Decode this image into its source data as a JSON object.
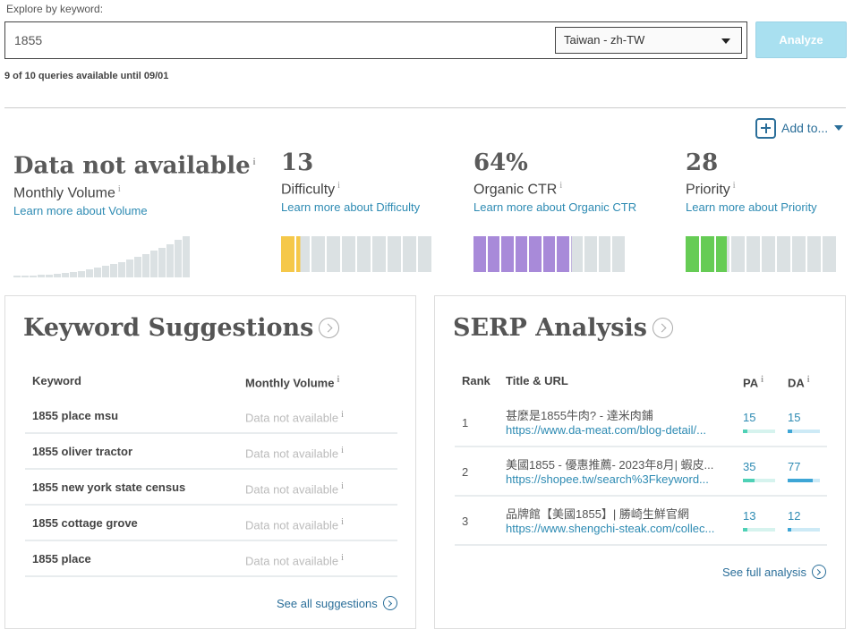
{
  "search": {
    "label": "Explore by keyword:",
    "value": "1855",
    "locale": "Taiwan - zh-TW",
    "analyze_label": "Analyze",
    "queries_text": "9 of 10 queries available until 09/01"
  },
  "add_to_label": "Add to...",
  "metrics": {
    "volume": {
      "value": "Data not available",
      "label": "Monthly Volume",
      "link": "Learn more about Volume"
    },
    "difficulty": {
      "value": "13",
      "label": "Difficulty",
      "link": "Learn more about Difficulty",
      "fill": 0.13,
      "color": "#f5c84a"
    },
    "ctr": {
      "value": "64%",
      "label": "Organic CTR",
      "link": "Learn more about Organic CTR",
      "fill": 0.64,
      "color": "#a88ad9"
    },
    "priority": {
      "value": "28",
      "label": "Priority",
      "link": "Learn more about Priority",
      "fill": 0.28,
      "color": "#66cc55"
    }
  },
  "suggestions": {
    "title": "Keyword Suggestions",
    "col_keyword": "Keyword",
    "col_volume": "Monthly Volume",
    "rows": [
      {
        "keyword": "1855 place msu",
        "volume": "Data not available"
      },
      {
        "keyword": "1855 oliver tractor",
        "volume": "Data not available"
      },
      {
        "keyword": "1855 new york state census",
        "volume": "Data not available"
      },
      {
        "keyword": "1855 cottage grove",
        "volume": "Data not available"
      },
      {
        "keyword": "1855 place",
        "volume": "Data not available"
      }
    ],
    "see_all": "See all suggestions"
  },
  "serp": {
    "title": "SERP Analysis",
    "col_rank": "Rank",
    "col_title": "Title & URL",
    "col_pa": "PA",
    "col_da": "DA",
    "rows": [
      {
        "rank": "1",
        "title": "甚麼是1855牛肉? - 達米肉鋪",
        "url": "https://www.da-meat.com/blog-detail/...",
        "pa": "15",
        "da": "15",
        "pa_fill": 0.15,
        "da_fill": 0.15
      },
      {
        "rank": "2",
        "title": "美國1855 - 優惠推薦- 2023年8月| 蝦皮...",
        "url": "https://shopee.tw/search%3Fkeyword...",
        "pa": "35",
        "da": "77",
        "pa_fill": 0.35,
        "da_fill": 0.77
      },
      {
        "rank": "3",
        "title": "品牌館【美國1855】| 勝崎生鮮官網",
        "url": "https://www.shengchi-steak.com/collec...",
        "pa": "13",
        "da": "12",
        "pa_fill": 0.13,
        "da_fill": 0.12
      }
    ],
    "see_full": "See full analysis"
  }
}
